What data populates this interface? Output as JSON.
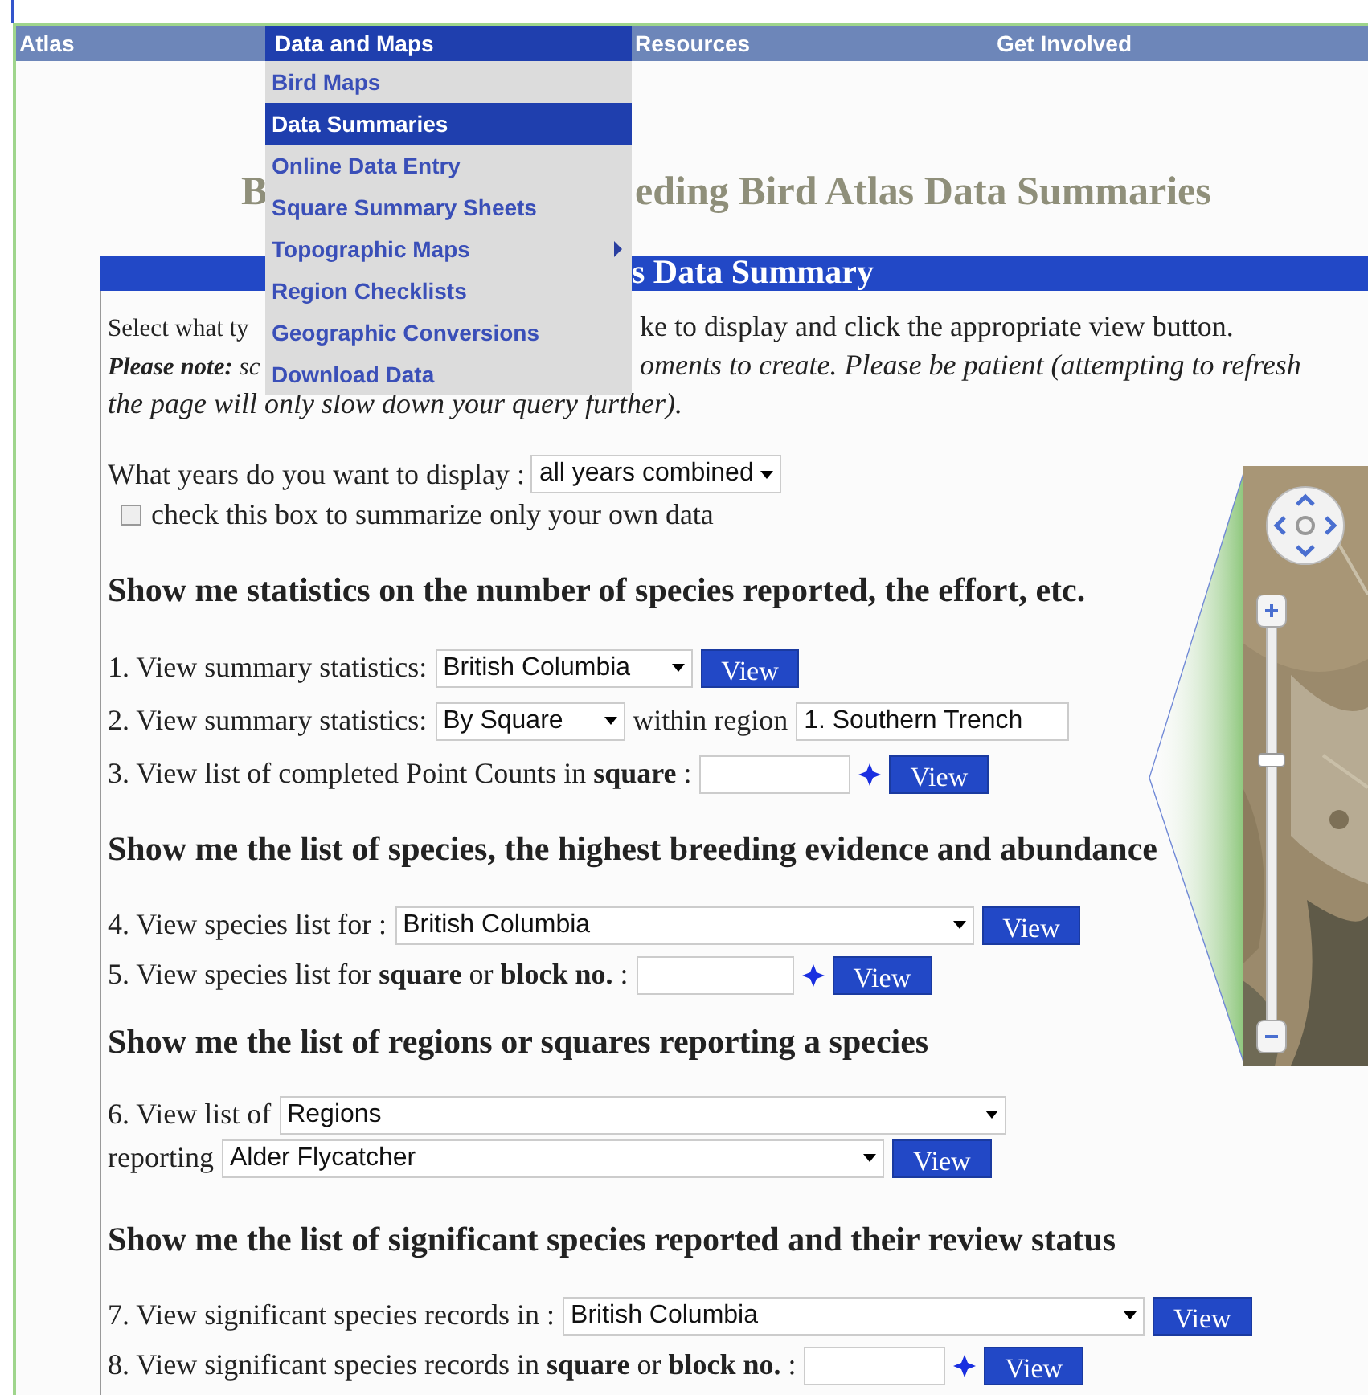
{
  "nav": [
    {
      "label": "Atlas",
      "selected": false
    },
    {
      "label": "Data and Maps",
      "selected": true
    },
    {
      "label": "Resources",
      "selected": false
    },
    {
      "label": "Get Involved",
      "selected": false
    }
  ],
  "dropdown": [
    {
      "label": "Bird Maps",
      "selected": false,
      "submenu": false
    },
    {
      "label": "Data Summaries",
      "selected": true,
      "submenu": false
    },
    {
      "label": "Online Data Entry",
      "selected": false,
      "submenu": false
    },
    {
      "label": "Square Summary Sheets",
      "selected": false,
      "submenu": false
    },
    {
      "label": "Topographic Maps",
      "selected": false,
      "submenu": true
    },
    {
      "label": "Region Checklists",
      "selected": false,
      "submenu": false
    },
    {
      "label": "Geographic Conversions",
      "selected": false,
      "submenu": false
    },
    {
      "label": "Download Data",
      "selected": false,
      "submenu": false
    }
  ],
  "title": {
    "before": "B",
    "after": "eding Bird Atlas Data Summaries"
  },
  "panel_header": "s Data Summary",
  "intro": [
    {
      "before": "Select what ty",
      "after": "ke to display and click the appropriate view button."
    },
    {
      "before": "**Please note:** sc",
      "after": "oments to create. Please be patient (attempting to refresh"
    },
    {
      "full": "the page will only slow down your query further)."
    }
  ],
  "years": {
    "label": "What years do you want to display :",
    "value": "all years combined"
  },
  "own_data": {
    "label": "check this box to summarize only your own data",
    "checked": false
  },
  "map": {
    "zoom": {
      "level": 0.66
    }
  },
  "sections": [
    {
      "heading": "Show me statistics on the number of species reported, the effort, etc.",
      "rows": [
        {
          "parts": [
            {
              "kind": "text",
              "text": "1. View summary statistics:"
            },
            {
              "kind": "select",
              "value": "British Columbia",
              "arrow": true
            },
            {
              "kind": "button",
              "label": "View"
            }
          ]
        },
        {
          "parts": [
            {
              "kind": "text",
              "text": "2. View summary statistics:"
            },
            {
              "kind": "select",
              "value": "By Square",
              "arrow": true
            },
            {
              "kind": "text",
              "text": "within region"
            },
            {
              "kind": "select",
              "value": "1. Southern Trench",
              "arrow": false
            }
          ]
        },
        {
          "parts": [
            {
              "kind": "text",
              "text": "3. View list of completed Point Counts in **square** :"
            },
            {
              "kind": "input"
            },
            {
              "kind": "lookup"
            },
            {
              "kind": "button",
              "label": "View"
            }
          ]
        }
      ]
    },
    {
      "heading": "Show me the list of species, the highest breeding evidence and abundance",
      "rows": [
        {
          "parts": [
            {
              "kind": "text",
              "text": "4. View species list for :"
            },
            {
              "kind": "select",
              "value": "British Columbia",
              "arrow": true
            },
            {
              "kind": "button",
              "label": "View"
            }
          ]
        },
        {
          "parts": [
            {
              "kind": "text",
              "text": "5. View species list for **square** or **block no.** :"
            },
            {
              "kind": "input"
            },
            {
              "kind": "lookup"
            },
            {
              "kind": "button",
              "label": "View"
            }
          ]
        }
      ]
    },
    {
      "heading": "Show me the list of regions or squares reporting a species",
      "rows": [
        {
          "parts": [
            {
              "kind": "text",
              "text": "6. View list of"
            },
            {
              "kind": "select",
              "value": "Regions",
              "arrow": true
            }
          ]
        },
        {
          "parts": [
            {
              "kind": "text",
              "text": "reporting"
            },
            {
              "kind": "select",
              "value": "Alder Flycatcher",
              "arrow": true
            },
            {
              "kind": "button",
              "label": "View"
            }
          ]
        }
      ]
    },
    {
      "heading": "Show me the list of significant species reported and their review status",
      "rows": [
        {
          "parts": [
            {
              "kind": "text",
              "text": "7. View significant species records in :"
            },
            {
              "kind": "select",
              "value": "British Columbia",
              "arrow": true
            },
            {
              "kind": "button",
              "label": "View"
            }
          ]
        },
        {
          "parts": [
            {
              "kind": "text",
              "text": "8. View significant species records in **square** or **block no.** :"
            },
            {
              "kind": "input"
            },
            {
              "kind": "lookup"
            },
            {
              "kind": "button",
              "label": "View"
            }
          ]
        }
      ]
    }
  ]
}
